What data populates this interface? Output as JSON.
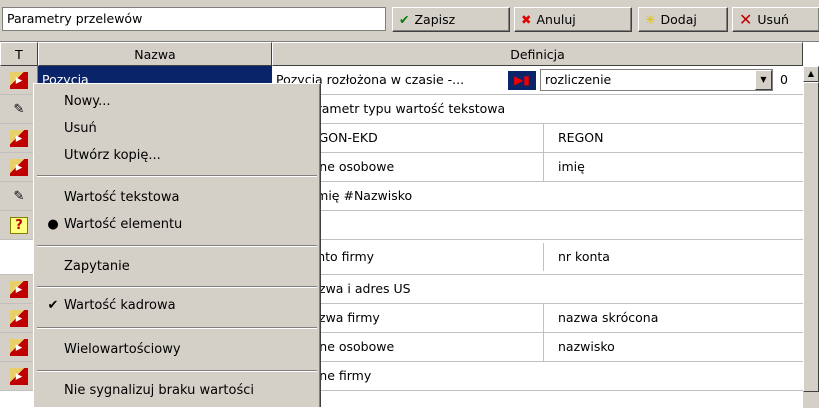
{
  "toolbar": {
    "title_value": "Parametry przelewów",
    "save_label": "Zapisz",
    "cancel_label": "Anuluj",
    "add_label": "Dodaj",
    "delete_label": "Usuń"
  },
  "grid": {
    "headers": {
      "t": "T",
      "name": "Nazwa",
      "definition": "Definicja"
    },
    "row0": {
      "name": "Pozycja",
      "definition": "Pozycja rozłożona w czasie -...",
      "combo_value": "rozliczenie",
      "number": "0"
    },
    "rows": [
      {
        "icon": "scroll-icon",
        "def1": "Parametr typu wartość tekstowa",
        "def2": ""
      },
      {
        "icon": "red-doc-icon",
        "def1": "REGON-EKD",
        "def2": "REGON"
      },
      {
        "icon": "red-doc-icon",
        "def1": "Dane osobowe",
        "def2": "imię"
      },
      {
        "icon": "scroll-icon",
        "def1": "#Imię #Nazwisko",
        "def2": ""
      },
      {
        "icon": "question-icon",
        "def1": "",
        "def2": ""
      },
      {
        "icon": "",
        "def1": "Konto firmy",
        "def2": "nr konta"
      },
      {
        "icon": "red-doc-icon",
        "def1": "Nazwa i adres US",
        "def2": ""
      },
      {
        "icon": "red-doc-icon",
        "def1": "Nazwa firmy",
        "def2": "nazwa skrócona"
      },
      {
        "icon": "red-doc-icon",
        "def1": "Dane osobowe",
        "def2": "nazwisko"
      },
      {
        "icon": "red-doc-icon",
        "def1": "Dane firmy",
        "def2": ""
      }
    ]
  },
  "context_menu": {
    "new": "Nowy...",
    "delete": "Usuń",
    "copy": "Utwórz kopię...",
    "text_value": "Wartość tekstowa",
    "element_value": "Wartość elementu",
    "query": "Zapytanie",
    "hr_value": "Wartość kadrowa",
    "multi_value": "Wielowartościowy",
    "no_signal": "Nie sygnalizuj braku wartości"
  },
  "colors": {
    "selection": "#0a246a",
    "face": "#d4d0c8"
  }
}
